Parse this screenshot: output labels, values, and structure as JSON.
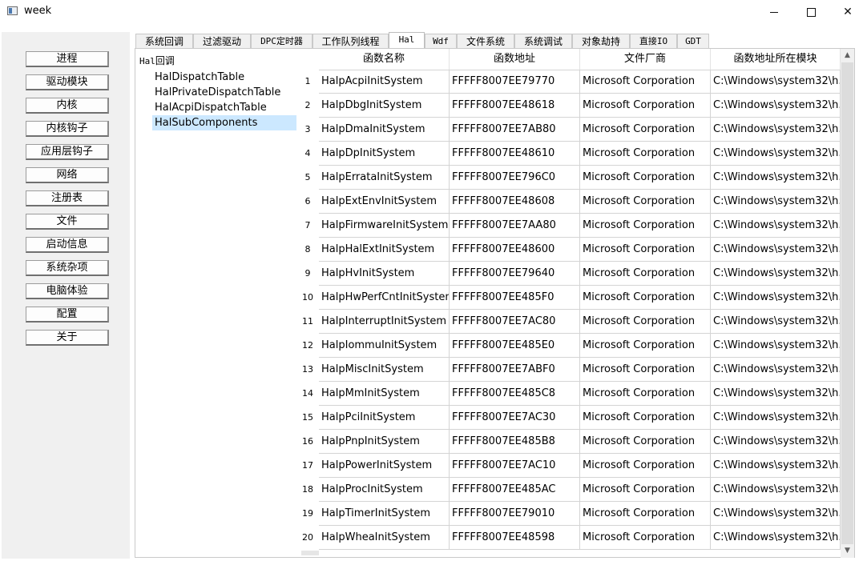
{
  "window": {
    "title": "week"
  },
  "nav": {
    "items": [
      "进程",
      "驱动模块",
      "内核",
      "内核钩子",
      "应用层钩子",
      "网络",
      "注册表",
      "文件",
      "启动信息",
      "系统杂项",
      "电脑体验",
      "配置",
      "关于"
    ]
  },
  "tabs": {
    "items": [
      "系统回调",
      "过滤驱动",
      "DPC定时器",
      "工作队列线程",
      "Hal",
      "Wdf",
      "文件系统",
      "系统调试",
      "对象劫持",
      "直接IO",
      "GDT"
    ],
    "active": "Hal"
  },
  "tree": {
    "header_prefix": "Hal",
    "header_suffix": "回调",
    "items": [
      "HalDispatchTable",
      "HalPrivateDispatchTable",
      "HalAcpiDispatchTable",
      "HalSubComponents"
    ],
    "selected": "HalSubComponents"
  },
  "table": {
    "columns": [
      "函数名称",
      "函数地址",
      "文件厂商",
      "函数地址所在模块"
    ],
    "rows": [
      [
        "1",
        "HalpAcpiInitSystem",
        "FFFFF8007EE79770",
        "Microsoft Corporation",
        "C:\\Windows\\system32\\h..."
      ],
      [
        "2",
        "HalpDbgInitSystem",
        "FFFFF8007EE48618",
        "Microsoft Corporation",
        "C:\\Windows\\system32\\h..."
      ],
      [
        "3",
        "HalpDmaInitSystem",
        "FFFFF8007EE7AB80",
        "Microsoft Corporation",
        "C:\\Windows\\system32\\h..."
      ],
      [
        "4",
        "HalpDpInitSystem",
        "FFFFF8007EE48610",
        "Microsoft Corporation",
        "C:\\Windows\\system32\\h..."
      ],
      [
        "5",
        "HalpErrataInitSystem",
        "FFFFF8007EE796C0",
        "Microsoft Corporation",
        "C:\\Windows\\system32\\h..."
      ],
      [
        "6",
        "HalpExtEnvInitSystem",
        "FFFFF8007EE48608",
        "Microsoft Corporation",
        "C:\\Windows\\system32\\h..."
      ],
      [
        "7",
        "HalpFirmwareInitSystem",
        "FFFFF8007EE7AA80",
        "Microsoft Corporation",
        "C:\\Windows\\system32\\h..."
      ],
      [
        "8",
        "HalpHalExtInitSystem",
        "FFFFF8007EE48600",
        "Microsoft Corporation",
        "C:\\Windows\\system32\\h..."
      ],
      [
        "9",
        "HalpHvInitSystem",
        "FFFFF8007EE79640",
        "Microsoft Corporation",
        "C:\\Windows\\system32\\h..."
      ],
      [
        "10",
        "HalpHwPerfCntInitSystem",
        "FFFFF8007EE485F0",
        "Microsoft Corporation",
        "C:\\Windows\\system32\\h..."
      ],
      [
        "11",
        "HalpInterruptInitSystem",
        "FFFFF8007EE7AC80",
        "Microsoft Corporation",
        "C:\\Windows\\system32\\h..."
      ],
      [
        "12",
        "HalpIommuInitSystem",
        "FFFFF8007EE485E0",
        "Microsoft Corporation",
        "C:\\Windows\\system32\\h..."
      ],
      [
        "13",
        "HalpMiscInitSystem",
        "FFFFF8007EE7ABF0",
        "Microsoft Corporation",
        "C:\\Windows\\system32\\h..."
      ],
      [
        "14",
        "HalpMmInitSystem",
        "FFFFF8007EE485C8",
        "Microsoft Corporation",
        "C:\\Windows\\system32\\h..."
      ],
      [
        "15",
        "HalpPciInitSystem",
        "FFFFF8007EE7AC30",
        "Microsoft Corporation",
        "C:\\Windows\\system32\\h..."
      ],
      [
        "16",
        "HalpPnpInitSystem",
        "FFFFF8007EE485B8",
        "Microsoft Corporation",
        "C:\\Windows\\system32\\h..."
      ],
      [
        "17",
        "HalpPowerInitSystem",
        "FFFFF8007EE7AC10",
        "Microsoft Corporation",
        "C:\\Windows\\system32\\h..."
      ],
      [
        "18",
        "HalpProcInitSystem",
        "FFFFF8007EE485AC",
        "Microsoft Corporation",
        "C:\\Windows\\system32\\h..."
      ],
      [
        "19",
        "HalpTimerInitSystem",
        "FFFFF8007EE79010",
        "Microsoft Corporation",
        "C:\\Windows\\system32\\h..."
      ],
      [
        "20",
        "HalpWheaInitSystem",
        "FFFFF8007EE48598",
        "Microsoft Corporation",
        "C:\\Windows\\system32\\h..."
      ]
    ]
  },
  "icons": {
    "app": "window-icon",
    "minimize": "minimize-icon",
    "maximize": "maximize-icon",
    "close": "close-icon",
    "scroll_up": "chevron-up-icon",
    "scroll_down": "chevron-down-icon"
  },
  "colors": {
    "selection": "#cce8ff",
    "panel": "#f0f0f0"
  }
}
